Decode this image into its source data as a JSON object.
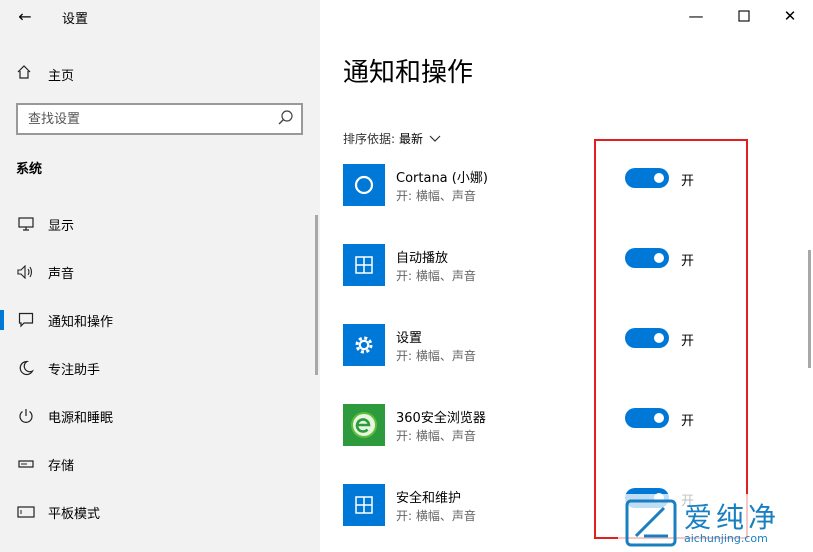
{
  "sidebar": {
    "app_title": "设置",
    "home_label": "主页",
    "search_placeholder": "查找设置",
    "section_title": "系统",
    "items": [
      {
        "label": "显示"
      },
      {
        "label": "声音"
      },
      {
        "label": "通知和操作"
      },
      {
        "label": "专注助手"
      },
      {
        "label": "电源和睡眠"
      },
      {
        "label": "存储"
      },
      {
        "label": "平板模式"
      }
    ]
  },
  "main": {
    "title": "通知和操作",
    "sort_label": "排序依据:",
    "sort_value": "最新",
    "apps": [
      {
        "name": "Cortana (小娜)",
        "sub": "开: 横幅、声音",
        "toggle": "开"
      },
      {
        "name": "自动播放",
        "sub": "开: 横幅、声音",
        "toggle": "开"
      },
      {
        "name": "设置",
        "sub": "开: 横幅、声音",
        "toggle": "开"
      },
      {
        "name": "360安全浏览器",
        "sub": "开: 横幅、声音",
        "toggle": "开"
      },
      {
        "name": "安全和维护",
        "sub": "开: 横幅、声音",
        "toggle": "开"
      }
    ]
  },
  "watermark": {
    "text": "爱纯净",
    "url": "aichunjing.com"
  },
  "colors": {
    "accent": "#0078d7",
    "highlight": "#e02020",
    "sidebar_bg": "#f2f2f2"
  }
}
